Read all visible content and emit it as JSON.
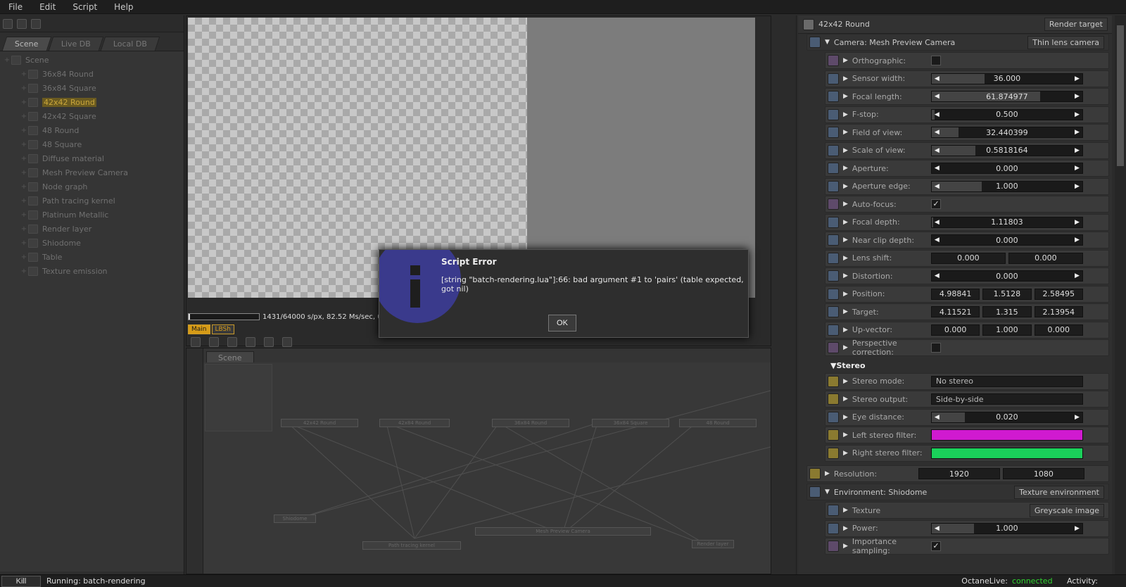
{
  "menu": [
    "File",
    "Edit",
    "Script",
    "Help"
  ],
  "left": {
    "tabs": [
      "Scene",
      "Live DB",
      "Local DB"
    ],
    "root": "Scene",
    "items": [
      "36x84 Round",
      "36x84 Square",
      "42x42 Round",
      "42x42 Square",
      "48 Round",
      "48 Square",
      "Diffuse material",
      "Mesh Preview Camera",
      "Node graph",
      "Path tracing kernel",
      "Platinum Metallic",
      "Render layer",
      "Shiodome",
      "Table",
      "Texture emission"
    ],
    "selected_index": 2
  },
  "viewport": {
    "status": "1431/64000 s/px, 82.52 Ms/sec, 00:00:36",
    "progress_fraction": 0.022,
    "tabs": [
      "Main",
      "LBSh"
    ]
  },
  "nodegraph": {
    "tab": "Scene",
    "nodes": [
      "42x42 Round",
      "42x84 Round",
      "36x84 Round",
      "36x84 Square",
      "48 Round",
      "Shiodome",
      "Path tracing kernel",
      "Mesh Preview Camera",
      "Render layer"
    ]
  },
  "inspector": {
    "header": {
      "title": "42x42 Round",
      "button": "Render target"
    },
    "camera": {
      "title": "Camera: Mesh Preview Camera",
      "button": "Thin lens camera"
    },
    "rows": [
      {
        "label": "Orthographic:",
        "kind": "check",
        "checked": false
      },
      {
        "label": "Sensor width:",
        "kind": "slider",
        "value": "36.000",
        "fill": 0.35
      },
      {
        "label": "Focal length:",
        "kind": "slider",
        "value": "61.874977",
        "fill": 0.72
      },
      {
        "label": "F-stop:",
        "kind": "slider",
        "value": "0.500",
        "fill": 0.02
      },
      {
        "label": "Field of view:",
        "kind": "slider",
        "value": "32.440399",
        "fill": 0.18
      },
      {
        "label": "Scale of view:",
        "kind": "slider",
        "value": "0.5818164",
        "fill": 0.29
      },
      {
        "label": "Aperture:",
        "kind": "slider",
        "value": "0.000",
        "fill": 0
      },
      {
        "label": "Aperture edge:",
        "kind": "slider",
        "value": "1.000",
        "fill": 0.33
      },
      {
        "label": "Auto-focus:",
        "kind": "check",
        "checked": true
      },
      {
        "label": "Focal depth:",
        "kind": "slider",
        "value": "1.11803",
        "fill": 0.01
      },
      {
        "label": "Near clip depth:",
        "kind": "slider",
        "value": "0.000",
        "fill": 0
      },
      {
        "label": "Lens shift:",
        "kind": "fields",
        "values": [
          "0.000",
          "0.000"
        ]
      },
      {
        "label": "Distortion:",
        "kind": "slider",
        "value": "0.000",
        "fill": 0
      },
      {
        "label": "Position:",
        "kind": "fields",
        "values": [
          "4.98841",
          "1.5128",
          "2.58495"
        ]
      },
      {
        "label": "Target:",
        "kind": "fields",
        "values": [
          "4.11521",
          "1.315",
          "2.13954"
        ]
      },
      {
        "label": "Up-vector:",
        "kind": "fields",
        "values": [
          "0.000",
          "1.000",
          "0.000"
        ]
      },
      {
        "label": "Perspective correction:",
        "kind": "check",
        "checked": false
      }
    ],
    "stereo": {
      "title": "Stereo",
      "rows": [
        {
          "label": "Stereo mode:",
          "kind": "combo",
          "value": "No stereo"
        },
        {
          "label": "Stereo output:",
          "kind": "combo",
          "value": "Side-by-side"
        },
        {
          "label": "Eye distance:",
          "kind": "slider",
          "value": "0.020",
          "fill": 0.22
        },
        {
          "label": "Left stereo filter:",
          "kind": "color",
          "value": "#d01ad0"
        },
        {
          "label": "Right stereo filter:",
          "kind": "color",
          "value": "#1ad05a"
        }
      ]
    },
    "resolution": {
      "label": "Resolution:",
      "values": [
        "1920",
        "1080"
      ]
    },
    "environment": {
      "title": "Environment: Shiodome",
      "button": "Texture environment"
    },
    "env_rows": [
      {
        "label": "Texture",
        "kind": "pill",
        "value": "Greyscale image"
      },
      {
        "label": "Power:",
        "kind": "slider",
        "value": "1.000",
        "fill": 0.28
      },
      {
        "label": "Importance sampling:",
        "kind": "check",
        "checked": true
      }
    ]
  },
  "dialog": {
    "title": "Script Error",
    "message": "[string \"batch-rendering.lua\"]:66: bad argument #1 to 'pairs' (table expected, got nil)",
    "ok": "OK"
  },
  "statusbar": {
    "kill": "Kill",
    "running": "Running: batch-rendering",
    "octane_label": "OctaneLive:",
    "octane_status": "connected",
    "activity": "Activity:",
    "connected_color": "#2fd12f"
  }
}
